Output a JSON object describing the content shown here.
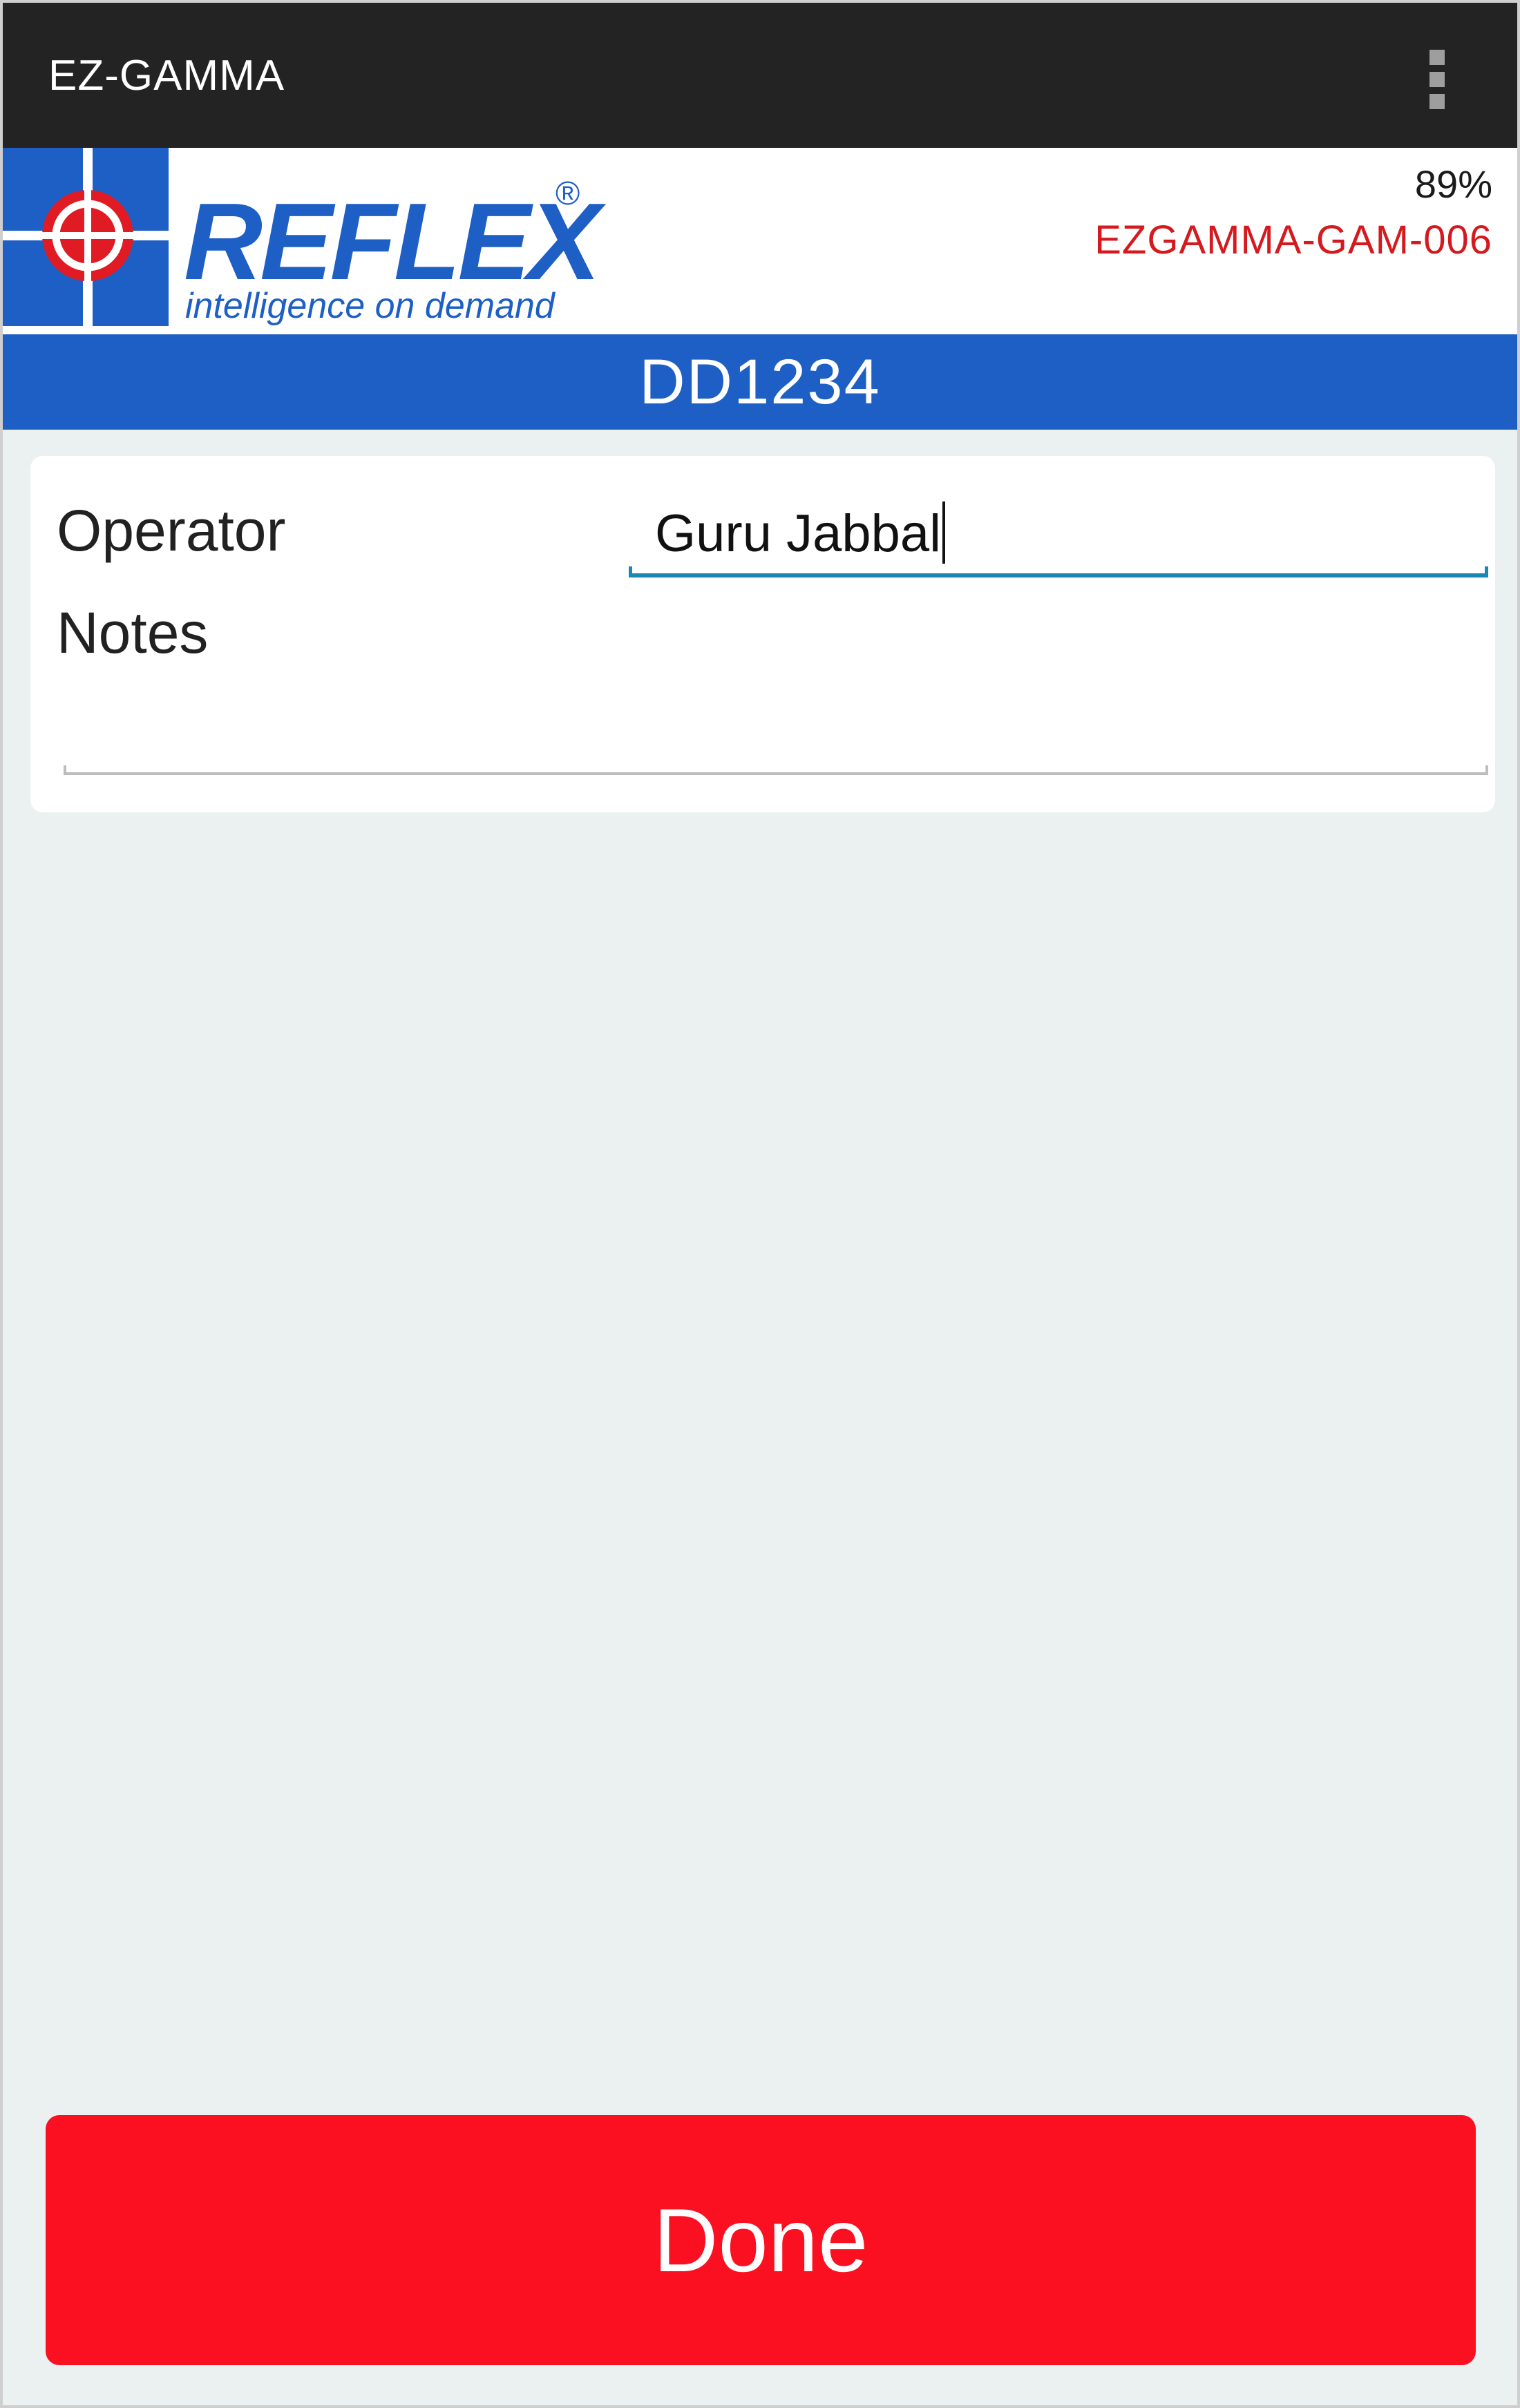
{
  "action_bar": {
    "title": "EZ-GAMMA"
  },
  "brand": {
    "logo_name": "REFLEX",
    "logo_registered": "®",
    "logo_tagline": "intelligence on demand",
    "battery_percent": "89%",
    "device_id": "EZGAMMA-GAM-006"
  },
  "hole_id": "DD1234",
  "form": {
    "operator_label": "Operator",
    "operator_value": "Guru Jabbal",
    "notes_label": "Notes",
    "notes_value": ""
  },
  "done_button": {
    "label": "Done"
  },
  "colors": {
    "action_bar_bg": "#232323",
    "brand_blue": "#1e5fc6",
    "device_id_red": "#d41a1f",
    "done_red": "#fb1021",
    "input_accent": "#1b87b3",
    "screen_bg": "#ebf1f1"
  },
  "icons": {
    "overflow_menu": "overflow-menu-icon",
    "logo_crosshair": "crosshair-target-icon"
  }
}
